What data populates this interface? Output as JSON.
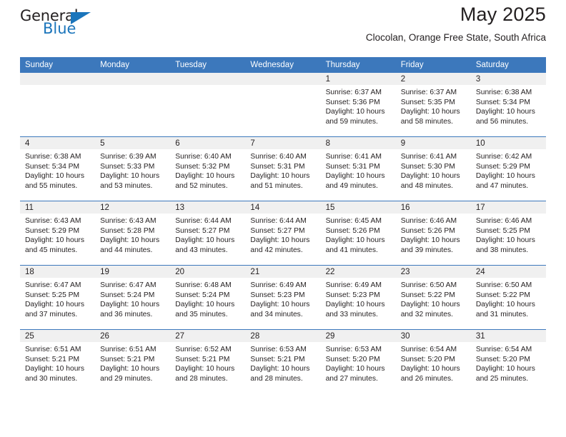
{
  "logo": {
    "text_primary": "General",
    "text_secondary": "Blue",
    "triangle_icon": "triangle-icon",
    "primary_color": "#231f20",
    "accent_color": "#1b75bb"
  },
  "header": {
    "title": "May 2025",
    "subtitle": "Clocolan, Orange Free State, South Africa"
  },
  "theme": {
    "header_bg": "#3c78bc",
    "header_text": "#ffffff",
    "daynum_bg": "#f0f0f0",
    "cell_bg": "#ffffff",
    "body_text": "#231f20"
  },
  "calendar": {
    "weekday_headers": [
      "Sunday",
      "Monday",
      "Tuesday",
      "Wednesday",
      "Thursday",
      "Friday",
      "Saturday"
    ],
    "weeks": [
      [
        {
          "day": "",
          "sunrise": "",
          "sunset": "",
          "daylight_line1": "",
          "daylight_line2": ""
        },
        {
          "day": "",
          "sunrise": "",
          "sunset": "",
          "daylight_line1": "",
          "daylight_line2": ""
        },
        {
          "day": "",
          "sunrise": "",
          "sunset": "",
          "daylight_line1": "",
          "daylight_line2": ""
        },
        {
          "day": "",
          "sunrise": "",
          "sunset": "",
          "daylight_line1": "",
          "daylight_line2": ""
        },
        {
          "day": "1",
          "sunrise": "Sunrise: 6:37 AM",
          "sunset": "Sunset: 5:36 PM",
          "daylight_line1": "Daylight: 10 hours",
          "daylight_line2": "and 59 minutes."
        },
        {
          "day": "2",
          "sunrise": "Sunrise: 6:37 AM",
          "sunset": "Sunset: 5:35 PM",
          "daylight_line1": "Daylight: 10 hours",
          "daylight_line2": "and 58 minutes."
        },
        {
          "day": "3",
          "sunrise": "Sunrise: 6:38 AM",
          "sunset": "Sunset: 5:34 PM",
          "daylight_line1": "Daylight: 10 hours",
          "daylight_line2": "and 56 minutes."
        }
      ],
      [
        {
          "day": "4",
          "sunrise": "Sunrise: 6:38 AM",
          "sunset": "Sunset: 5:34 PM",
          "daylight_line1": "Daylight: 10 hours",
          "daylight_line2": "and 55 minutes."
        },
        {
          "day": "5",
          "sunrise": "Sunrise: 6:39 AM",
          "sunset": "Sunset: 5:33 PM",
          "daylight_line1": "Daylight: 10 hours",
          "daylight_line2": "and 53 minutes."
        },
        {
          "day": "6",
          "sunrise": "Sunrise: 6:40 AM",
          "sunset": "Sunset: 5:32 PM",
          "daylight_line1": "Daylight: 10 hours",
          "daylight_line2": "and 52 minutes."
        },
        {
          "day": "7",
          "sunrise": "Sunrise: 6:40 AM",
          "sunset": "Sunset: 5:31 PM",
          "daylight_line1": "Daylight: 10 hours",
          "daylight_line2": "and 51 minutes."
        },
        {
          "day": "8",
          "sunrise": "Sunrise: 6:41 AM",
          "sunset": "Sunset: 5:31 PM",
          "daylight_line1": "Daylight: 10 hours",
          "daylight_line2": "and 49 minutes."
        },
        {
          "day": "9",
          "sunrise": "Sunrise: 6:41 AM",
          "sunset": "Sunset: 5:30 PM",
          "daylight_line1": "Daylight: 10 hours",
          "daylight_line2": "and 48 minutes."
        },
        {
          "day": "10",
          "sunrise": "Sunrise: 6:42 AM",
          "sunset": "Sunset: 5:29 PM",
          "daylight_line1": "Daylight: 10 hours",
          "daylight_line2": "and 47 minutes."
        }
      ],
      [
        {
          "day": "11",
          "sunrise": "Sunrise: 6:43 AM",
          "sunset": "Sunset: 5:29 PM",
          "daylight_line1": "Daylight: 10 hours",
          "daylight_line2": "and 45 minutes."
        },
        {
          "day": "12",
          "sunrise": "Sunrise: 6:43 AM",
          "sunset": "Sunset: 5:28 PM",
          "daylight_line1": "Daylight: 10 hours",
          "daylight_line2": "and 44 minutes."
        },
        {
          "day": "13",
          "sunrise": "Sunrise: 6:44 AM",
          "sunset": "Sunset: 5:27 PM",
          "daylight_line1": "Daylight: 10 hours",
          "daylight_line2": "and 43 minutes."
        },
        {
          "day": "14",
          "sunrise": "Sunrise: 6:44 AM",
          "sunset": "Sunset: 5:27 PM",
          "daylight_line1": "Daylight: 10 hours",
          "daylight_line2": "and 42 minutes."
        },
        {
          "day": "15",
          "sunrise": "Sunrise: 6:45 AM",
          "sunset": "Sunset: 5:26 PM",
          "daylight_line1": "Daylight: 10 hours",
          "daylight_line2": "and 41 minutes."
        },
        {
          "day": "16",
          "sunrise": "Sunrise: 6:46 AM",
          "sunset": "Sunset: 5:26 PM",
          "daylight_line1": "Daylight: 10 hours",
          "daylight_line2": "and 39 minutes."
        },
        {
          "day": "17",
          "sunrise": "Sunrise: 6:46 AM",
          "sunset": "Sunset: 5:25 PM",
          "daylight_line1": "Daylight: 10 hours",
          "daylight_line2": "and 38 minutes."
        }
      ],
      [
        {
          "day": "18",
          "sunrise": "Sunrise: 6:47 AM",
          "sunset": "Sunset: 5:25 PM",
          "daylight_line1": "Daylight: 10 hours",
          "daylight_line2": "and 37 minutes."
        },
        {
          "day": "19",
          "sunrise": "Sunrise: 6:47 AM",
          "sunset": "Sunset: 5:24 PM",
          "daylight_line1": "Daylight: 10 hours",
          "daylight_line2": "and 36 minutes."
        },
        {
          "day": "20",
          "sunrise": "Sunrise: 6:48 AM",
          "sunset": "Sunset: 5:24 PM",
          "daylight_line1": "Daylight: 10 hours",
          "daylight_line2": "and 35 minutes."
        },
        {
          "day": "21",
          "sunrise": "Sunrise: 6:49 AM",
          "sunset": "Sunset: 5:23 PM",
          "daylight_line1": "Daylight: 10 hours",
          "daylight_line2": "and 34 minutes."
        },
        {
          "day": "22",
          "sunrise": "Sunrise: 6:49 AM",
          "sunset": "Sunset: 5:23 PM",
          "daylight_line1": "Daylight: 10 hours",
          "daylight_line2": "and 33 minutes."
        },
        {
          "day": "23",
          "sunrise": "Sunrise: 6:50 AM",
          "sunset": "Sunset: 5:22 PM",
          "daylight_line1": "Daylight: 10 hours",
          "daylight_line2": "and 32 minutes."
        },
        {
          "day": "24",
          "sunrise": "Sunrise: 6:50 AM",
          "sunset": "Sunset: 5:22 PM",
          "daylight_line1": "Daylight: 10 hours",
          "daylight_line2": "and 31 minutes."
        }
      ],
      [
        {
          "day": "25",
          "sunrise": "Sunrise: 6:51 AM",
          "sunset": "Sunset: 5:21 PM",
          "daylight_line1": "Daylight: 10 hours",
          "daylight_line2": "and 30 minutes."
        },
        {
          "day": "26",
          "sunrise": "Sunrise: 6:51 AM",
          "sunset": "Sunset: 5:21 PM",
          "daylight_line1": "Daylight: 10 hours",
          "daylight_line2": "and 29 minutes."
        },
        {
          "day": "27",
          "sunrise": "Sunrise: 6:52 AM",
          "sunset": "Sunset: 5:21 PM",
          "daylight_line1": "Daylight: 10 hours",
          "daylight_line2": "and 28 minutes."
        },
        {
          "day": "28",
          "sunrise": "Sunrise: 6:53 AM",
          "sunset": "Sunset: 5:21 PM",
          "daylight_line1": "Daylight: 10 hours",
          "daylight_line2": "and 28 minutes."
        },
        {
          "day": "29",
          "sunrise": "Sunrise: 6:53 AM",
          "sunset": "Sunset: 5:20 PM",
          "daylight_line1": "Daylight: 10 hours",
          "daylight_line2": "and 27 minutes."
        },
        {
          "day": "30",
          "sunrise": "Sunrise: 6:54 AM",
          "sunset": "Sunset: 5:20 PM",
          "daylight_line1": "Daylight: 10 hours",
          "daylight_line2": "and 26 minutes."
        },
        {
          "day": "31",
          "sunrise": "Sunrise: 6:54 AM",
          "sunset": "Sunset: 5:20 PM",
          "daylight_line1": "Daylight: 10 hours",
          "daylight_line2": "and 25 minutes."
        }
      ]
    ]
  }
}
